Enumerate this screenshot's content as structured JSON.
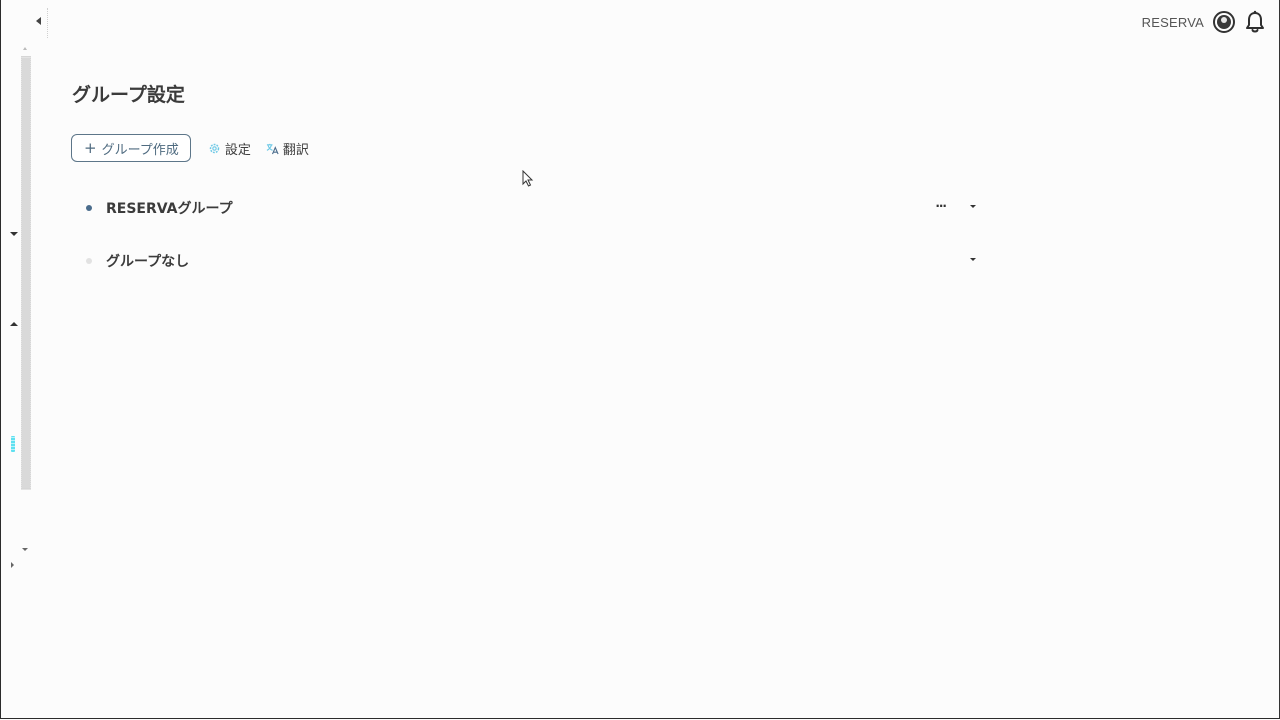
{
  "header": {
    "account_name": "RESERVA",
    "avatar_icon": "account-circle-icon",
    "bell_icon": "bell-icon"
  },
  "page": {
    "title": "グループ設定"
  },
  "toolbar": {
    "create_label": "グループ作成",
    "create_icon": "plus-icon",
    "settings_label": "設定",
    "settings_icon": "gear-icon",
    "translate_label": "翻訳",
    "translate_icon": "translate-icon"
  },
  "groups": [
    {
      "name": "RESERVAグループ",
      "has_menu": true,
      "bullet": "filled"
    },
    {
      "name": "グループなし",
      "has_menu": false,
      "bullet": "empty"
    }
  ],
  "colors": {
    "accent": "#4f6b80",
    "bullet_active": "#4a6c8c",
    "cyan_marker": "#5fe0f0",
    "background": "#fcfcfc"
  }
}
